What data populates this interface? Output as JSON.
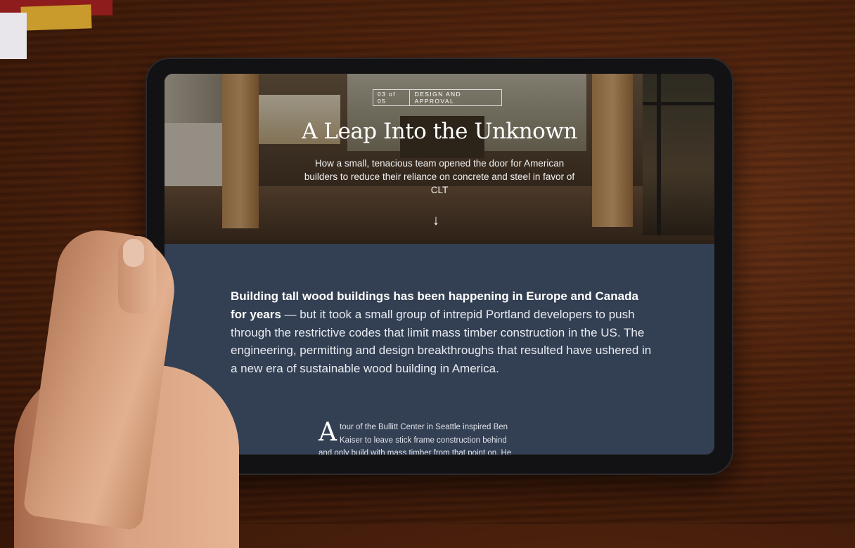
{
  "article": {
    "chapter": "03 of 05",
    "section": "DESIGN AND APPROVAL",
    "title": "A Leap Into the Unknown",
    "subtitle": "How a small, tenacious team opened the door for American builders to reduce their reliance on concrete and steel in favor of CLT",
    "scroll_icon": "down-arrow-icon",
    "lead_bold": "Building tall wood buildings has been happening in Europe and Canada for years",
    "lead_rest": " — but it took a small group of intrepid Portland developers to push through the restrictive codes that limit mass timber construction in the US. The engineering, permitting and design breakthroughs that resulted have ushered in a new era of sustainable wood building in America.",
    "dropcap": "A",
    "body_text": "tour of the Bullitt Center in Seattle inspired Ben Kaiser to leave stick frame construction behind and only build with mass timber from that point on. He saw wood"
  }
}
